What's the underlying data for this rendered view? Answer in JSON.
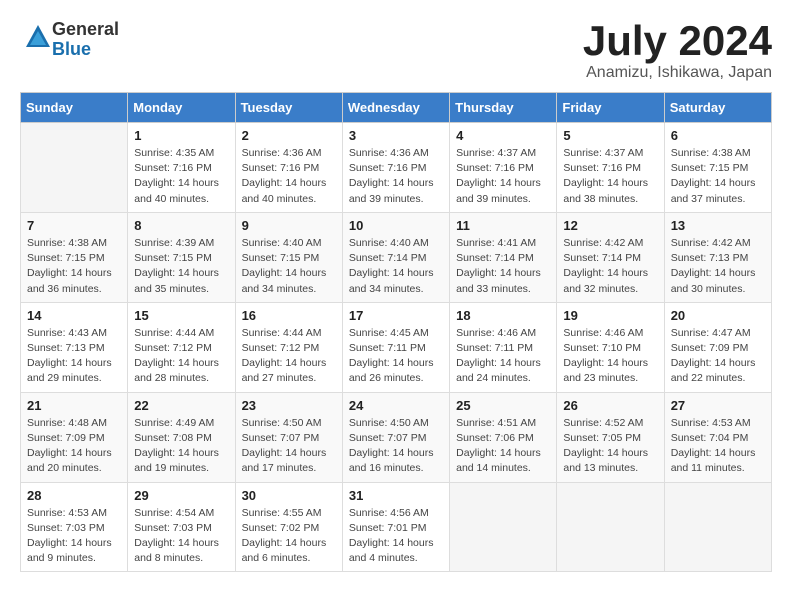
{
  "logo": {
    "general": "General",
    "blue": "Blue"
  },
  "title": "July 2024",
  "subtitle": "Anamizu, Ishikawa, Japan",
  "weekdays": [
    "Sunday",
    "Monday",
    "Tuesday",
    "Wednesday",
    "Thursday",
    "Friday",
    "Saturday"
  ],
  "weeks": [
    [
      {
        "day": "",
        "info": ""
      },
      {
        "day": "1",
        "info": "Sunrise: 4:35 AM\nSunset: 7:16 PM\nDaylight: 14 hours\nand 40 minutes."
      },
      {
        "day": "2",
        "info": "Sunrise: 4:36 AM\nSunset: 7:16 PM\nDaylight: 14 hours\nand 40 minutes."
      },
      {
        "day": "3",
        "info": "Sunrise: 4:36 AM\nSunset: 7:16 PM\nDaylight: 14 hours\nand 39 minutes."
      },
      {
        "day": "4",
        "info": "Sunrise: 4:37 AM\nSunset: 7:16 PM\nDaylight: 14 hours\nand 39 minutes."
      },
      {
        "day": "5",
        "info": "Sunrise: 4:37 AM\nSunset: 7:16 PM\nDaylight: 14 hours\nand 38 minutes."
      },
      {
        "day": "6",
        "info": "Sunrise: 4:38 AM\nSunset: 7:15 PM\nDaylight: 14 hours\nand 37 minutes."
      }
    ],
    [
      {
        "day": "7",
        "info": "Sunrise: 4:38 AM\nSunset: 7:15 PM\nDaylight: 14 hours\nand 36 minutes."
      },
      {
        "day": "8",
        "info": "Sunrise: 4:39 AM\nSunset: 7:15 PM\nDaylight: 14 hours\nand 35 minutes."
      },
      {
        "day": "9",
        "info": "Sunrise: 4:40 AM\nSunset: 7:15 PM\nDaylight: 14 hours\nand 34 minutes."
      },
      {
        "day": "10",
        "info": "Sunrise: 4:40 AM\nSunset: 7:14 PM\nDaylight: 14 hours\nand 34 minutes."
      },
      {
        "day": "11",
        "info": "Sunrise: 4:41 AM\nSunset: 7:14 PM\nDaylight: 14 hours\nand 33 minutes."
      },
      {
        "day": "12",
        "info": "Sunrise: 4:42 AM\nSunset: 7:14 PM\nDaylight: 14 hours\nand 32 minutes."
      },
      {
        "day": "13",
        "info": "Sunrise: 4:42 AM\nSunset: 7:13 PM\nDaylight: 14 hours\nand 30 minutes."
      }
    ],
    [
      {
        "day": "14",
        "info": "Sunrise: 4:43 AM\nSunset: 7:13 PM\nDaylight: 14 hours\nand 29 minutes."
      },
      {
        "day": "15",
        "info": "Sunrise: 4:44 AM\nSunset: 7:12 PM\nDaylight: 14 hours\nand 28 minutes."
      },
      {
        "day": "16",
        "info": "Sunrise: 4:44 AM\nSunset: 7:12 PM\nDaylight: 14 hours\nand 27 minutes."
      },
      {
        "day": "17",
        "info": "Sunrise: 4:45 AM\nSunset: 7:11 PM\nDaylight: 14 hours\nand 26 minutes."
      },
      {
        "day": "18",
        "info": "Sunrise: 4:46 AM\nSunset: 7:11 PM\nDaylight: 14 hours\nand 24 minutes."
      },
      {
        "day": "19",
        "info": "Sunrise: 4:46 AM\nSunset: 7:10 PM\nDaylight: 14 hours\nand 23 minutes."
      },
      {
        "day": "20",
        "info": "Sunrise: 4:47 AM\nSunset: 7:09 PM\nDaylight: 14 hours\nand 22 minutes."
      }
    ],
    [
      {
        "day": "21",
        "info": "Sunrise: 4:48 AM\nSunset: 7:09 PM\nDaylight: 14 hours\nand 20 minutes."
      },
      {
        "day": "22",
        "info": "Sunrise: 4:49 AM\nSunset: 7:08 PM\nDaylight: 14 hours\nand 19 minutes."
      },
      {
        "day": "23",
        "info": "Sunrise: 4:50 AM\nSunset: 7:07 PM\nDaylight: 14 hours\nand 17 minutes."
      },
      {
        "day": "24",
        "info": "Sunrise: 4:50 AM\nSunset: 7:07 PM\nDaylight: 14 hours\nand 16 minutes."
      },
      {
        "day": "25",
        "info": "Sunrise: 4:51 AM\nSunset: 7:06 PM\nDaylight: 14 hours\nand 14 minutes."
      },
      {
        "day": "26",
        "info": "Sunrise: 4:52 AM\nSunset: 7:05 PM\nDaylight: 14 hours\nand 13 minutes."
      },
      {
        "day": "27",
        "info": "Sunrise: 4:53 AM\nSunset: 7:04 PM\nDaylight: 14 hours\nand 11 minutes."
      }
    ],
    [
      {
        "day": "28",
        "info": "Sunrise: 4:53 AM\nSunset: 7:03 PM\nDaylight: 14 hours\nand 9 minutes."
      },
      {
        "day": "29",
        "info": "Sunrise: 4:54 AM\nSunset: 7:03 PM\nDaylight: 14 hours\nand 8 minutes."
      },
      {
        "day": "30",
        "info": "Sunrise: 4:55 AM\nSunset: 7:02 PM\nDaylight: 14 hours\nand 6 minutes."
      },
      {
        "day": "31",
        "info": "Sunrise: 4:56 AM\nSunset: 7:01 PM\nDaylight: 14 hours\nand 4 minutes."
      },
      {
        "day": "",
        "info": ""
      },
      {
        "day": "",
        "info": ""
      },
      {
        "day": "",
        "info": ""
      }
    ]
  ]
}
